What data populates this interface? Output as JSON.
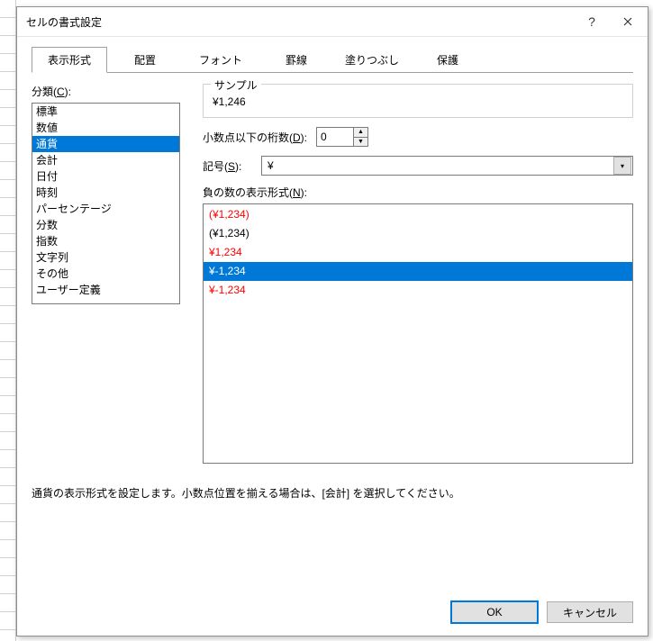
{
  "window": {
    "title": "セルの書式設定"
  },
  "tabs": [
    {
      "label": "表示形式",
      "active": true
    },
    {
      "label": "配置",
      "active": false
    },
    {
      "label": "フォント",
      "active": false
    },
    {
      "label": "罫線",
      "active": false
    },
    {
      "label": "塗りつぶし",
      "active": false
    },
    {
      "label": "保護",
      "active": false
    }
  ],
  "category": {
    "label_prefix": "分類(",
    "label_key": "C",
    "label_suffix": "):",
    "items": [
      "標準",
      "数値",
      "通貨",
      "会計",
      "日付",
      "時刻",
      "パーセンテージ",
      "分数",
      "指数",
      "文字列",
      "その他",
      "ユーザー定義"
    ],
    "selected_index": 2
  },
  "sample": {
    "label": "サンプル",
    "value": "¥1,246"
  },
  "decimals": {
    "label_prefix": "小数点以下の桁数(",
    "label_key": "D",
    "label_suffix": "):",
    "value": "0"
  },
  "symbol": {
    "label_prefix": "記号(",
    "label_key": "S",
    "label_suffix": "):",
    "value": "¥"
  },
  "negative": {
    "label_prefix": "負の数の表示形式(",
    "label_key": "N",
    "label_suffix": "):",
    "options": [
      {
        "text": "(¥1,234)",
        "color": "red",
        "selected": false
      },
      {
        "text": "(¥1,234)",
        "color": "black",
        "selected": false
      },
      {
        "text": "¥1,234",
        "color": "red",
        "selected": false
      },
      {
        "text": "¥-1,234",
        "color": "black",
        "selected": true
      },
      {
        "text": "¥-1,234",
        "color": "red",
        "selected": false
      }
    ]
  },
  "description": "通貨の表示形式を設定します。小数点位置を揃える場合は、[会計] を選択してください。",
  "buttons": {
    "ok": "OK",
    "cancel": "キャンセル"
  }
}
